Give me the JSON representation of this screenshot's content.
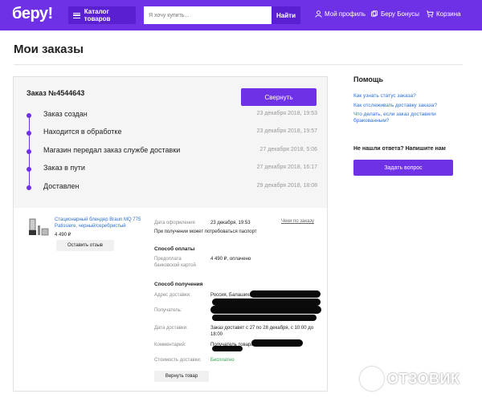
{
  "header": {
    "logo": "беру!",
    "catalog_label": "Каталог товаров",
    "search_placeholder": "Я хочу купить...",
    "search_button": "Найти",
    "nav": {
      "profile": "Мой профиль",
      "bonuses": "Беру Бонусы",
      "cart": "Корзина"
    },
    "colors": {
      "brand": "#6f31e6",
      "brand_dark": "#5a1fd1"
    }
  },
  "page": {
    "title": "Мои заказы"
  },
  "order": {
    "number": "Заказ №4544643",
    "collapse_label": "Свернуть",
    "statuses": [
      {
        "label": "Заказ создан",
        "date": "23 декабря 2018, 19:53"
      },
      {
        "label": "Находится в обработке",
        "date": "23 декабря 2018, 19:57"
      },
      {
        "label": "Магазин передал заказ службе доставки",
        "date": "27 декабря 2018, 5:06"
      },
      {
        "label": "Заказ в пути",
        "date": "27 декабря 2018, 16:17"
      },
      {
        "label": "Доставлен",
        "date": "29 декабря 2018, 18:08"
      }
    ],
    "product": {
      "name": "Стационарный блендер Braun MQ 775 Patissiere, черный/серебристый",
      "price": "4 490 ₽",
      "review_button": "Оставить отзыв",
      "image_icon": "blender-icon"
    },
    "details": {
      "date_label": "Дата оформления",
      "date_value": "23 декабря, 19:53",
      "receipt_link": "Чеки по заказу",
      "passport_note": "При получении может потребоваться паспорт",
      "payment_title": "Способ оплаты",
      "payment_label": "Предоплата банковской картой",
      "payment_value": "4 490 ₽, оплачено",
      "delivery_title": "Способ получения",
      "address_label": "Адрес доставки:",
      "address_value": "Россия, Балашиха",
      "recipient_label": "Получатель:",
      "delivery_date_label": "Дата доставки:",
      "delivery_date_value": "Заказ доставят с 27 по 28 декабря, с 10:00 до 18:00",
      "comment_label": "Комментарий:",
      "comment_value": "Получатель товара",
      "cost_label": "Стоимость доставки:",
      "cost_value": "Бесплатно"
    },
    "return_button": "Вернуть товар"
  },
  "help": {
    "title": "Помощь",
    "links": [
      "Как узнать статус заказа?",
      "Как отслеживать доставку заказа?",
      "Что делать, если заказ доставили бракованным?"
    ],
    "question": "Не нашли ответа? Напишите нам",
    "ask_button": "Задать вопрос"
  },
  "watermark": {
    "text": "ОТЗОВИК"
  }
}
